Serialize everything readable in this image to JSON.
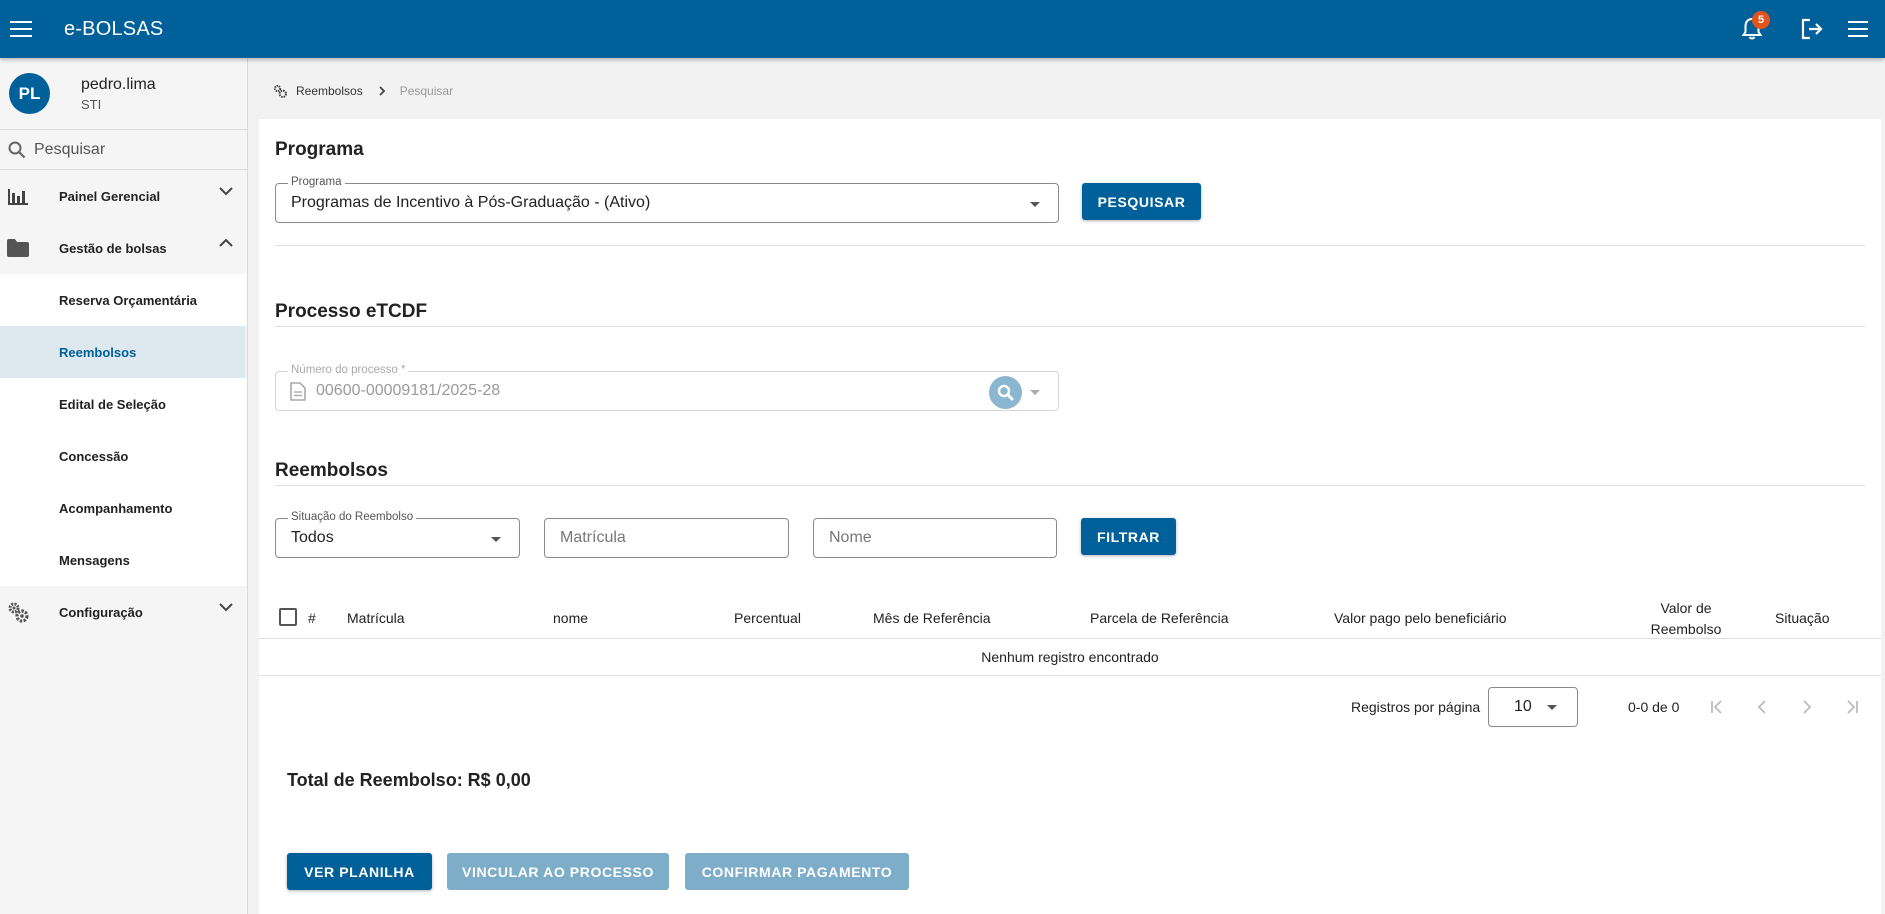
{
  "app": {
    "title": "e-BOLSAS",
    "notification_count": "5"
  },
  "user": {
    "initials": "PL",
    "name": "pedro.lima",
    "dept": "STI"
  },
  "sidebar": {
    "search_placeholder": "Pesquisar",
    "items": [
      {
        "label": "Painel Gerencial",
        "icon": "bar-chart-icon"
      },
      {
        "label": "Gestão de bolsas",
        "icon": "folder-icon"
      },
      {
        "label": "Configuração",
        "icon": "gears-icon"
      }
    ],
    "subitems": [
      {
        "label": "Reserva Orçamentária"
      },
      {
        "label": "Reembolsos"
      },
      {
        "label": "Edital de Seleção"
      },
      {
        "label": "Concessão"
      },
      {
        "label": "Acompanhamento"
      },
      {
        "label": "Mensagens"
      }
    ]
  },
  "breadcrumb": {
    "parent": "Reembolsos",
    "current": "Pesquisar"
  },
  "programa": {
    "title": "Programa",
    "field_label": "Programa",
    "field_value": "Programas de Incentivo à Pós-Graduação - (Ativo)",
    "search_button": "PESQUISAR"
  },
  "processo": {
    "title": "Processo eTCDF",
    "field_label": "Número do processo *",
    "field_value": "00600-00009181/2025-28"
  },
  "reembolsos": {
    "title": "Reembolsos",
    "situacao_label": "Situação do Reembolso",
    "situacao_value": "Todos",
    "matricula_placeholder": "Matrícula",
    "nome_placeholder": "Nome",
    "filter_button": "FILTRAR"
  },
  "table": {
    "columns": [
      "#",
      "Matrícula",
      "nome",
      "Percentual",
      "Mês de Referência",
      "Parcela de Referência",
      "Valor pago pelo beneficiário",
      "Valor de",
      "Reembolso",
      "Situação"
    ],
    "empty_message": "Nenhum registro encontrado"
  },
  "pager": {
    "rows_label": "Registros por página",
    "rows_value": "10",
    "range": "0-0 de 0"
  },
  "total": {
    "text": "Total de Reembolso: R$ 0,00"
  },
  "actions": {
    "ver_planilha": "VER PLANILHA",
    "vincular": "VINCULAR AO PROCESSO",
    "confirmar": "CONFIRMAR PAGAMENTO"
  },
  "colors": {
    "primary": "#00619a",
    "disabled": "#7eadc9",
    "badge": "#e2541b"
  }
}
